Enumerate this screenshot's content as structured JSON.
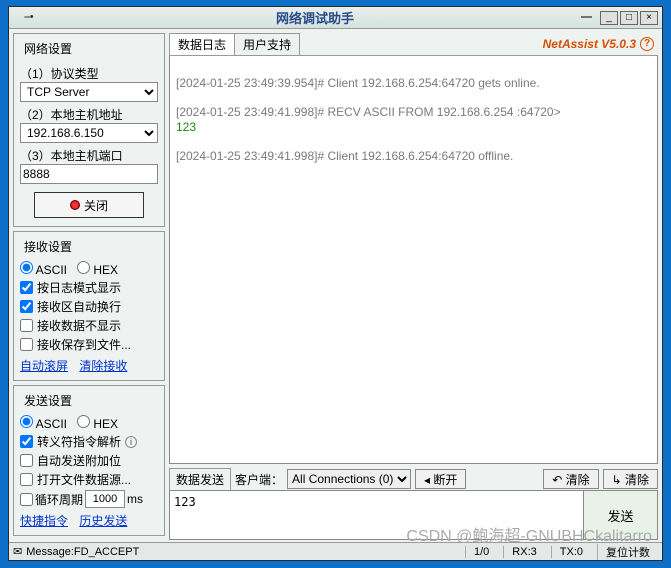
{
  "window": {
    "title": "网络调试助手"
  },
  "net": {
    "legend": "网络设置",
    "proto_label": "（1）协议类型",
    "proto_value": "TCP Server",
    "host_label": "（2）本地主机地址",
    "host_value": "192.168.6.150",
    "port_label": "（3）本地主机端口",
    "port_value": "8888",
    "close_btn": "关闭"
  },
  "recv": {
    "legend": "接收设置",
    "ascii": "ASCII",
    "hex": "HEX",
    "opt1": "按日志模式显示",
    "opt2": "接收区自动换行",
    "opt3": "接收数据不显示",
    "opt4": "接收保存到文件...",
    "link1": "自动滚屏",
    "link2": "清除接收"
  },
  "send": {
    "legend": "发送设置",
    "ascii": "ASCII",
    "hex": "HEX",
    "opt1": "转义符指令解析",
    "opt2": "自动发送附加位",
    "opt3": "打开文件数据源...",
    "cycle_label": "循环周期",
    "cycle_value": "1000",
    "cycle_unit": "ms",
    "link1": "快捷指令",
    "link2": "历史发送"
  },
  "tabs": {
    "log": "数据日志",
    "support": "用户支持",
    "brand": "NetAssist V5.0.3"
  },
  "log": {
    "l1h": "[2024-01-25 23:49:39.954]# Client 192.168.6.254:64720 gets online.",
    "l2h": "[2024-01-25 23:49:41.998]# RECV ASCII FROM 192.168.6.254 :64720>",
    "l2b": "123",
    "l3h": "[2024-01-25 23:49:41.998]# Client 192.168.6.254:64720 offline."
  },
  "sendbar": {
    "label": "数据发送",
    "client_label": "客户端：",
    "conn_value": "All Connections (0)",
    "disconnect": "◂ 断开",
    "clear1": "↶ 清除",
    "clear2": "↳ 清除",
    "input": "123",
    "send_btn": "发送"
  },
  "status": {
    "msg_label": "Message",
    "msg_value": "FD_ACCEPT",
    "ratio": "1/0",
    "rx": "RX:3",
    "tx": "TX:0",
    "reset": "复位计数"
  },
  "watermark": "CSDN @鲍海超-GNUBHCkalitarro"
}
